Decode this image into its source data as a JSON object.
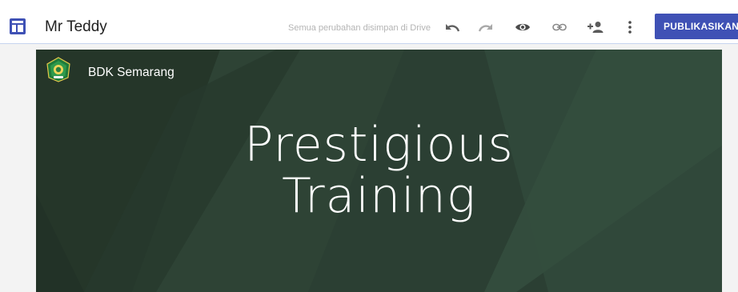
{
  "header": {
    "app_icon": "sites-layout-icon",
    "title": "Mr Teddy",
    "save_status": "Semua perubahan disimpan di Drive",
    "tools": [
      "undo-icon",
      "redo-icon",
      "eye-icon",
      "link-icon",
      "add-person-icon",
      "more-vert-icon"
    ],
    "publish_label": "PUBLIKASIKAN",
    "accent_color": "#3f51b5"
  },
  "banner": {
    "site_name": "BDK Semarang",
    "logo": "kemenag-emblem",
    "title_line1": "Prestigious",
    "title_line2": "Training",
    "bg_color": "#2a3d31"
  }
}
